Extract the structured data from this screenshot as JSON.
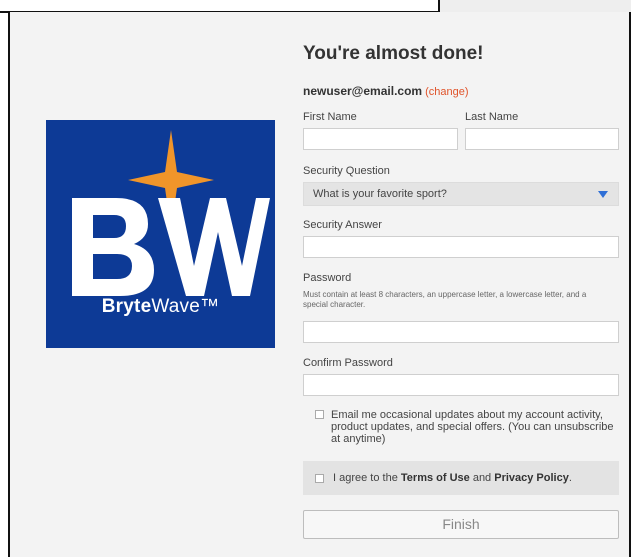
{
  "logo": {
    "mark": "BW",
    "name_bold": "Bryte",
    "name_regular": "Wave™",
    "background_color": "#0d3a96",
    "star_color": "#f0952a"
  },
  "form": {
    "title": "You're almost done!",
    "email": "newuser@email.com",
    "change_link": "(change)",
    "first_name_label": "First Name",
    "last_name_label": "Last Name",
    "security_question_label": "Security Question",
    "security_question_value": "What is your favorite sport?",
    "security_answer_label": "Security Answer",
    "password_label": "Password",
    "password_hint": "Must contain at least 8 characters, an uppercase letter, a lowercase letter, and a special character.",
    "confirm_password_label": "Confirm Password",
    "email_updates_text": "Email me occasional updates about my account activity, product updates, and special offers. (You can unsubscribe at anytime)",
    "agree_prefix": "I agree to the ",
    "terms_link": "Terms of Use",
    "agree_and": " and ",
    "privacy_link": "Privacy Policy",
    "agree_suffix": ".",
    "finish_button": "Finish",
    "accent_color": "#e0532a",
    "dropdown_arrow_color": "#2f6fd6"
  }
}
